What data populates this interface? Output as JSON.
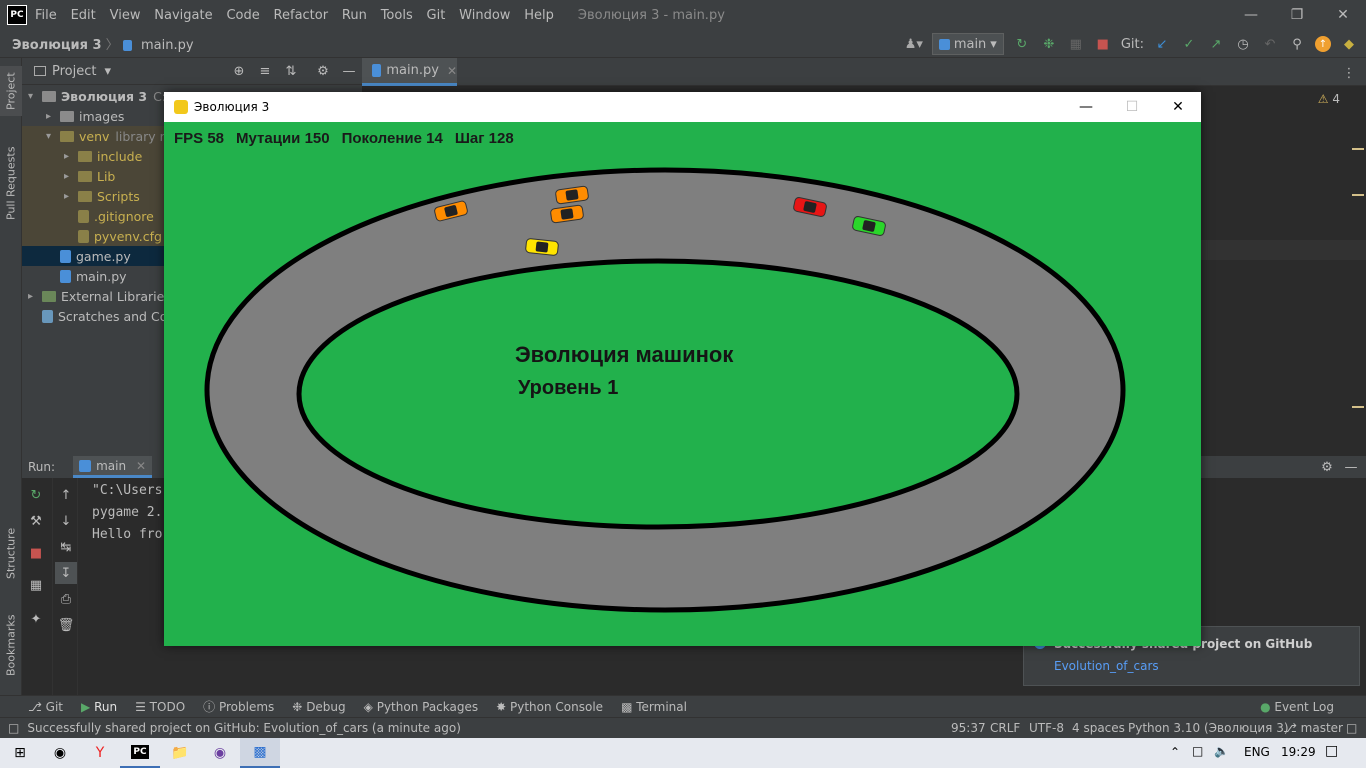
{
  "ide": {
    "logo": "PC",
    "menu": [
      "File",
      "Edit",
      "View",
      "Navigate",
      "Code",
      "Refactor",
      "Run",
      "Tools",
      "Git",
      "Window",
      "Help"
    ],
    "window_title": "Эволюция 3 - main.py",
    "breadcrumb_project": "Эволюция 3",
    "breadcrumb_file": "main.py",
    "branch_run_config": "main",
    "git_label": "Git:",
    "project_tab": "Project",
    "editor_tab": "main.py",
    "warnings_count": "4",
    "left_tabs": [
      "Project",
      "Pull Requests",
      "Structure",
      "Bookmarks"
    ]
  },
  "tree": [
    {
      "label": "Эволюция 3",
      "extra": "C:\\U",
      "kind": "folder",
      "indent": 0,
      "open": true,
      "bold": true
    },
    {
      "label": "images",
      "kind": "folder",
      "indent": 1,
      "open": false
    },
    {
      "label": "venv",
      "extra": "library ro",
      "kind": "folder-y",
      "indent": 1,
      "open": true
    },
    {
      "label": "include",
      "kind": "folder-y",
      "indent": 2,
      "open": false
    },
    {
      "label": "Lib",
      "kind": "folder-y",
      "indent": 2,
      "open": false
    },
    {
      "label": "Scripts",
      "kind": "folder-y",
      "indent": 2,
      "open": false
    },
    {
      "label": ".gitignore",
      "kind": "file-y",
      "indent": 2
    },
    {
      "label": "pyvenv.cfg",
      "kind": "file-y",
      "indent": 2
    },
    {
      "label": "game.py",
      "kind": "file",
      "indent": 1,
      "selected": true
    },
    {
      "label": "main.py",
      "kind": "file",
      "indent": 1
    },
    {
      "label": "External Libraries",
      "kind": "lib",
      "indent": 0,
      "open": false
    },
    {
      "label": "Scratches and Con",
      "kind": "scratch",
      "indent": 0
    }
  ],
  "run": {
    "label": "Run:",
    "config": "main",
    "lines": [
      "\"C:\\Users",
      "pygame 2.",
      "Hello fro"
    ]
  },
  "bottom_tabs": [
    "Git",
    "Run",
    "TODO",
    "Problems",
    "Debug",
    "Python Packages",
    "Python Console",
    "Terminal"
  ],
  "event_log": "Event Log",
  "status": {
    "message": "Successfully shared project on GitHub: Evolution_of_cars (a minute ago)",
    "position": "95:37",
    "line_sep": "CRLF",
    "encoding": "UTF-8",
    "indent": "4 spaces",
    "interpreter": "Python 3.10 (Эволюция 3)",
    "branch": "master"
  },
  "notification": {
    "title": "Successfully shared project on GitHub",
    "link": "Evolution_of_cars"
  },
  "taskbar": {
    "lang": "ENG",
    "time": "19:29"
  },
  "game": {
    "title": "Эволюция 3",
    "hud": {
      "fps": "FPS 58",
      "mutations": "Мутации 150",
      "generation": "Поколение 14",
      "step": "Шаг 128"
    },
    "heading": "Эволюция машинок",
    "level": "Уровень 1",
    "colors": {
      "grass": "#22b14c",
      "track": "#7f7f7f",
      "border": "#000000"
    },
    "cars": [
      {
        "color": "#ff8c00"
      },
      {
        "color": "#ff8c00"
      },
      {
        "color": "#ff8c00"
      },
      {
        "color": "#ffe400"
      },
      {
        "color": "#e81515"
      },
      {
        "color": "#2ad62a"
      }
    ]
  }
}
